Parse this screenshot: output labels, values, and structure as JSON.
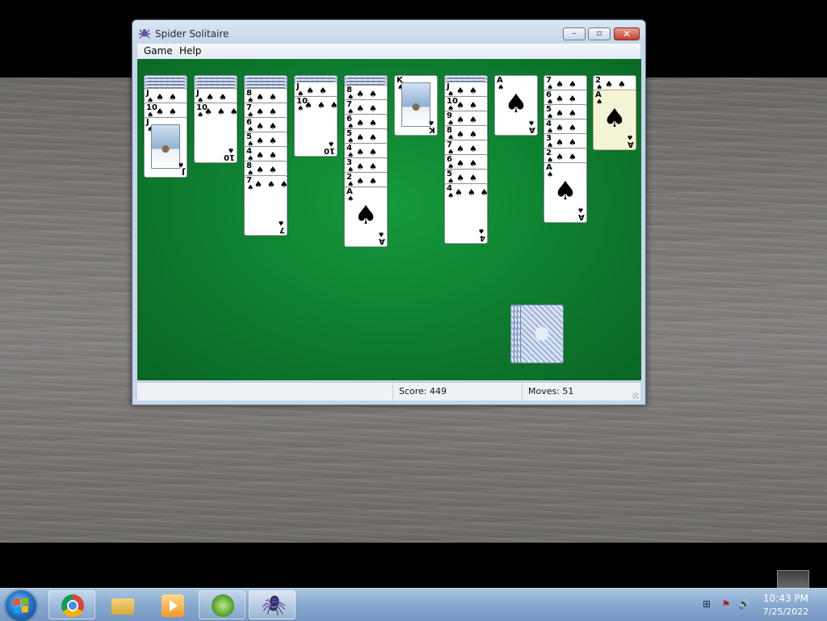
{
  "window": {
    "title": "Spider Solitaire",
    "minimize": "–",
    "maximize": "▫",
    "close": "✕"
  },
  "menu": {
    "game": "Game",
    "help": "Help"
  },
  "status": {
    "score": "Score: 449",
    "moves": "Moves:   51"
  },
  "tableau": [
    {
      "name": "column-1",
      "cards": [
        {
          "type": "back"
        },
        {
          "type": "back"
        },
        {
          "type": "back"
        },
        {
          "type": "back"
        },
        {
          "type": "face",
          "rank": "J"
        },
        {
          "type": "face",
          "rank": "10"
        },
        {
          "type": "face",
          "rank": "J",
          "art": true
        }
      ]
    },
    {
      "name": "column-2",
      "cards": [
        {
          "type": "back"
        },
        {
          "type": "back"
        },
        {
          "type": "back"
        },
        {
          "type": "back"
        },
        {
          "type": "face",
          "rank": "J"
        },
        {
          "type": "face",
          "rank": "10",
          "pips": 10
        }
      ]
    },
    {
      "name": "column-3",
      "cards": [
        {
          "type": "back"
        },
        {
          "type": "back"
        },
        {
          "type": "back"
        },
        {
          "type": "back"
        },
        {
          "type": "face",
          "rank": "8"
        },
        {
          "type": "face",
          "rank": "7"
        },
        {
          "type": "face",
          "rank": "6"
        },
        {
          "type": "face",
          "rank": "5"
        },
        {
          "type": "face",
          "rank": "4"
        },
        {
          "type": "face",
          "rank": "8"
        },
        {
          "type": "face",
          "rank": "7",
          "pips": 7
        }
      ]
    },
    {
      "name": "column-4",
      "cards": [
        {
          "type": "back"
        },
        {
          "type": "back"
        },
        {
          "type": "face",
          "rank": "J"
        },
        {
          "type": "face",
          "rank": "10",
          "pips": 10
        }
      ]
    },
    {
      "name": "column-5",
      "cards": [
        {
          "type": "back"
        },
        {
          "type": "back"
        },
        {
          "type": "back"
        },
        {
          "type": "face",
          "rank": "8"
        },
        {
          "type": "face",
          "rank": "7"
        },
        {
          "type": "face",
          "rank": "6"
        },
        {
          "type": "face",
          "rank": "5"
        },
        {
          "type": "face",
          "rank": "4"
        },
        {
          "type": "face",
          "rank": "3"
        },
        {
          "type": "face",
          "rank": "2"
        },
        {
          "type": "face",
          "rank": "A",
          "big": true
        }
      ]
    },
    {
      "name": "column-6",
      "cards": [
        {
          "type": "face",
          "rank": "K",
          "art": true
        }
      ]
    },
    {
      "name": "column-7",
      "cards": [
        {
          "type": "back"
        },
        {
          "type": "back"
        },
        {
          "type": "face",
          "rank": "J"
        },
        {
          "type": "face",
          "rank": "10"
        },
        {
          "type": "face",
          "rank": "9"
        },
        {
          "type": "face",
          "rank": "8"
        },
        {
          "type": "face",
          "rank": "7"
        },
        {
          "type": "face",
          "rank": "6"
        },
        {
          "type": "face",
          "rank": "5"
        },
        {
          "type": "face",
          "rank": "4",
          "pips": 4
        }
      ]
    },
    {
      "name": "column-8",
      "cards": [
        {
          "type": "face",
          "rank": "A",
          "big": true
        }
      ]
    },
    {
      "name": "column-9",
      "cards": [
        {
          "type": "face",
          "rank": "7"
        },
        {
          "type": "face",
          "rank": "6"
        },
        {
          "type": "face",
          "rank": "5"
        },
        {
          "type": "face",
          "rank": "4"
        },
        {
          "type": "face",
          "rank": "3"
        },
        {
          "type": "face",
          "rank": "2"
        },
        {
          "type": "face",
          "rank": "A",
          "big": true
        }
      ]
    },
    {
      "name": "column-10",
      "cards": [
        {
          "type": "face",
          "rank": "2"
        },
        {
          "type": "face",
          "rank": "A",
          "big": true,
          "highlight": true
        }
      ]
    }
  ],
  "suit_symbol": "♠",
  "taskbar": {
    "clock_time": "10:43 PM",
    "clock_date": "7/25/2022",
    "apps": [
      "chrome-icon",
      "file-explorer-icon",
      "media-player-icon",
      "windows-update-icon",
      "spider-solitaire-icon"
    ]
  },
  "tray": {
    "network": "⊞",
    "flag": "⚑",
    "volume": "🔊"
  }
}
